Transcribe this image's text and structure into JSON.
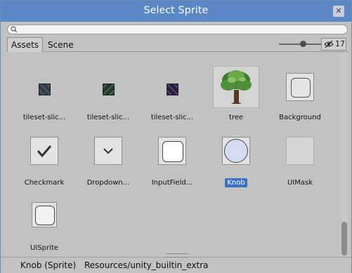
{
  "window": {
    "title": "Select Sprite"
  },
  "search": {
    "placeholder": "",
    "value": ""
  },
  "tabs": [
    {
      "label": "Assets",
      "active": true
    },
    {
      "label": "Scene",
      "active": false
    }
  ],
  "counter": {
    "value": "17",
    "icon": "hidden-eye-icon"
  },
  "slider": {
    "level": 0.55
  },
  "items": [
    {
      "label": "tileset-slic...",
      "kind": "tile",
      "color": "#2f3a3a"
    },
    {
      "label": "tileset-slic...",
      "kind": "tile",
      "color": "#273a2e"
    },
    {
      "label": "tileset-slic...",
      "kind": "tile",
      "color": "#2a2440"
    },
    {
      "label": "tree",
      "kind": "tree"
    },
    {
      "label": "Background",
      "kind": "background"
    },
    {
      "label": "Checkmark",
      "kind": "checkmark"
    },
    {
      "label": "Dropdown...",
      "kind": "dropdown"
    },
    {
      "label": "InputField...",
      "kind": "inputfield"
    },
    {
      "label": "Knob",
      "kind": "knob",
      "selected": true
    },
    {
      "label": "UIMask",
      "kind": "uimask"
    },
    {
      "label": "UISprite",
      "kind": "uisprite"
    }
  ],
  "status": {
    "name": "Knob (Sprite)",
    "path": "Resources/unity_builtin_extra"
  },
  "colors": {
    "titlebar": "#5b87c4",
    "selection": "#3a72c0",
    "background": "#c2c2c2"
  }
}
